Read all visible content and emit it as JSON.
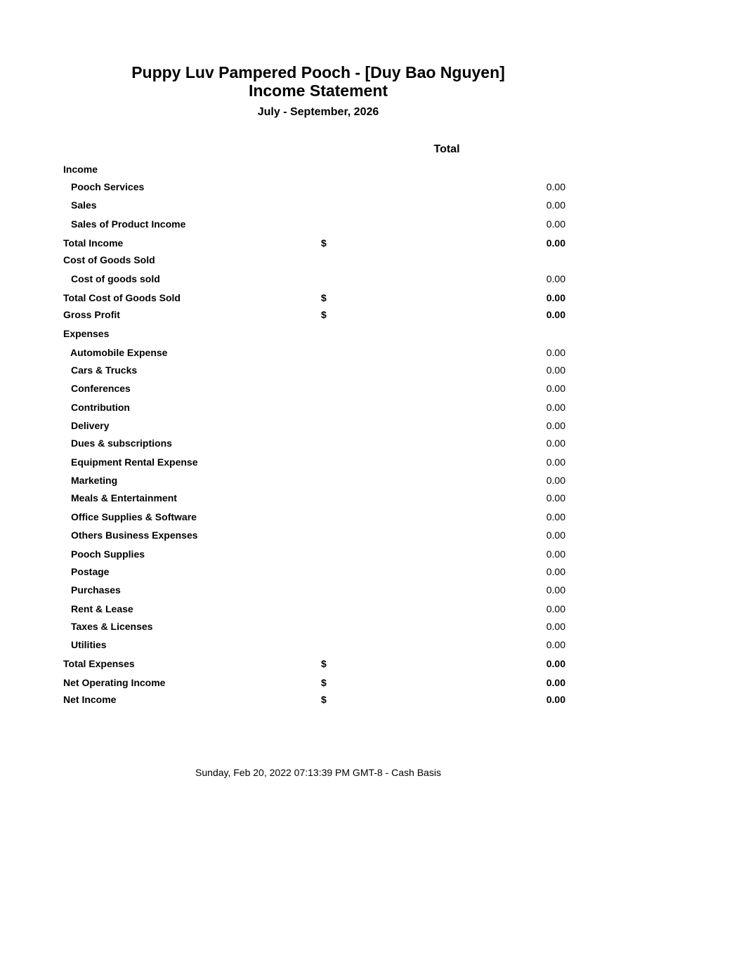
{
  "header": {
    "company": "Puppy Luv Pampered Pooch - [Duy Bao Nguyen]",
    "report_title": "Income Statement",
    "period": "July - September, 2026"
  },
  "columns": {
    "total_label": "Total"
  },
  "rows": [
    {
      "label": "Income",
      "type": "section"
    },
    {
      "label": "Pooch Services",
      "type": "item",
      "amount": "0.00"
    },
    {
      "label": "Sales",
      "type": "item",
      "amount": "0.00"
    },
    {
      "label": "Sales of Product Income",
      "type": "item",
      "amount": "0.00"
    },
    {
      "label": "Total Income",
      "type": "total",
      "currency": "$",
      "amount": "0.00"
    },
    {
      "label": "Cost of Goods Sold",
      "type": "section"
    },
    {
      "label": "Cost of goods sold",
      "type": "item",
      "amount": "0.00"
    },
    {
      "label": "Total Cost of Goods Sold",
      "type": "total",
      "currency": "$",
      "amount": "0.00"
    },
    {
      "label": "Gross Profit",
      "type": "total",
      "currency": "$",
      "amount": "0.00"
    },
    {
      "label": "Expenses",
      "type": "section"
    },
    {
      "label": "Automobile Expense",
      "type": "item",
      "amount": "0.00"
    },
    {
      "label": "Cars & Trucks",
      "type": "item",
      "amount": "0.00"
    },
    {
      "label": "Conferences",
      "type": "item",
      "amount": "0.00"
    },
    {
      "label": "Contribution",
      "type": "item",
      "amount": "0.00"
    },
    {
      "label": "Delivery",
      "type": "item",
      "amount": "0.00"
    },
    {
      "label": "Dues & subscriptions",
      "type": "item",
      "amount": "0.00"
    },
    {
      "label": "Equipment Rental Expense",
      "type": "item",
      "amount": "0.00"
    },
    {
      "label": "Marketing",
      "type": "item",
      "amount": "0.00"
    },
    {
      "label": "Meals & Entertainment",
      "type": "item",
      "amount": "0.00"
    },
    {
      "label": "Office Supplies & Software",
      "type": "item",
      "amount": "0.00"
    },
    {
      "label": "Others Business Expenses",
      "type": "item",
      "amount": "0.00"
    },
    {
      "label": "Pooch Supplies",
      "type": "item",
      "amount": "0.00"
    },
    {
      "label": "Postage",
      "type": "item",
      "amount": "0.00"
    },
    {
      "label": "Purchases",
      "type": "item",
      "amount": "0.00"
    },
    {
      "label": "Rent & Lease",
      "type": "item",
      "amount": "0.00"
    },
    {
      "label": "Taxes & Licenses",
      "type": "item",
      "amount": "0.00"
    },
    {
      "label": "Utilities",
      "type": "item",
      "amount": "0.00"
    },
    {
      "label": "Total Expenses",
      "type": "total",
      "currency": "$",
      "amount": "0.00"
    },
    {
      "label": "Net Operating Income",
      "type": "total",
      "currency": "$",
      "amount": "0.00"
    },
    {
      "label": "Net Income",
      "type": "total",
      "currency": "$",
      "amount": "0.00"
    }
  ],
  "footer": {
    "timestamp_basis": "Sunday, Feb 20, 2022 07:13:39 PM GMT-8 - Cash Basis"
  }
}
